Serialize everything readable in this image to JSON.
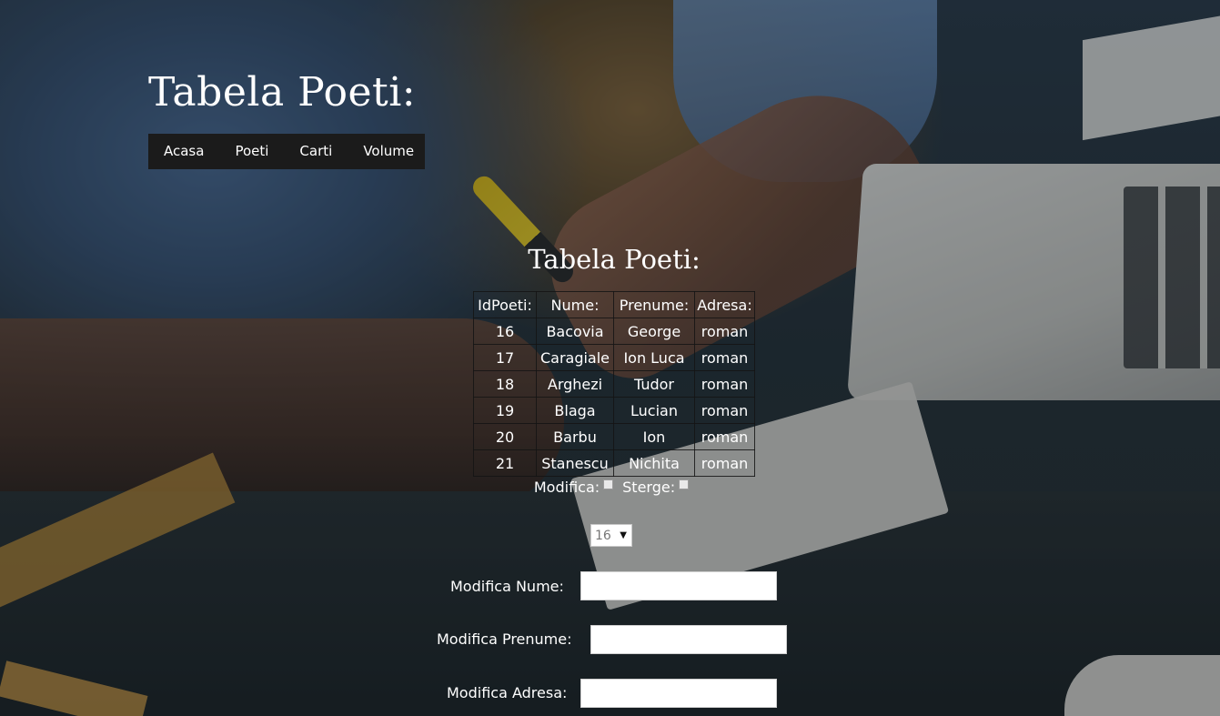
{
  "header": {
    "title": "Tabela Poeti:",
    "nav": [
      "Acasa",
      "Poeti",
      "Carti",
      "Volume"
    ]
  },
  "section": {
    "title": "Tabela Poeti:"
  },
  "table": {
    "columns": [
      "IdPoeti:",
      "Nume:",
      "Prenume:",
      "Adresa:"
    ],
    "rows": [
      [
        "16",
        "Bacovia",
        "George",
        "roman"
      ],
      [
        "17",
        "Caragiale",
        "Ion Luca",
        "roman"
      ],
      [
        "18",
        "Arghezi",
        "Tudor",
        "roman"
      ],
      [
        "19",
        "Blaga",
        "Lucian",
        "roman"
      ],
      [
        "20",
        "Barbu",
        "Ion",
        "roman"
      ],
      [
        "21",
        "Stanescu",
        "Nichita",
        "roman"
      ]
    ]
  },
  "options": {
    "modifica_label": "Modifica:",
    "sterge_label": "Sterge:",
    "selected_id": "16"
  },
  "form": {
    "nume_label": "Modifica Nume:",
    "prenume_label": "Modifica Prenume:",
    "adresa_label": "Modifica Adresa:"
  }
}
